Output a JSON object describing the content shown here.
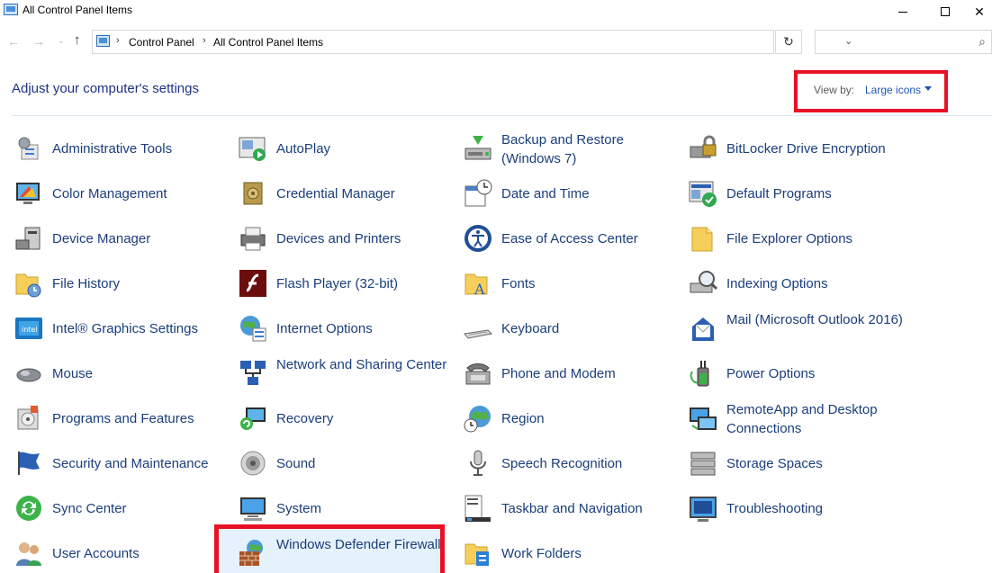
{
  "window": {
    "title": "All Control Panel Items"
  },
  "address": {
    "crumbs": [
      "Control Panel",
      "All Control Panel Items"
    ]
  },
  "header": {
    "title": "Adjust your computer's settings",
    "view_by_label": "View by:",
    "view_by_value": "Large icons"
  },
  "items": {
    "c0": [
      "Administrative Tools",
      "Color Management",
      "Device Manager",
      "File History",
      "Intel® Graphics Settings",
      "Mouse",
      "Programs and Features",
      "Security and Maintenance",
      "Sync Center",
      "User Accounts"
    ],
    "c1": [
      "AutoPlay",
      "Credential Manager",
      "Devices and Printers",
      "Flash Player (32-bit)",
      "Internet Options",
      "Network and Sharing Center",
      "Recovery",
      "Sound",
      "System",
      "Windows Defender Firewall"
    ],
    "c2": [
      "Backup and Restore (Windows 7)",
      "Date and Time",
      "Ease of Access Center",
      "Fonts",
      "Keyboard",
      "Phone and Modem",
      "Region",
      "Speech Recognition",
      "Taskbar and Navigation",
      "Work Folders"
    ],
    "c3": [
      "BitLocker Drive Encryption",
      "Default Programs",
      "File Explorer Options",
      "Indexing Options",
      "Mail (Microsoft Outlook 2016)",
      "Power Options",
      "RemoteApp and Desktop Connections",
      "Storage Spaces",
      "Troubleshooting"
    ]
  }
}
